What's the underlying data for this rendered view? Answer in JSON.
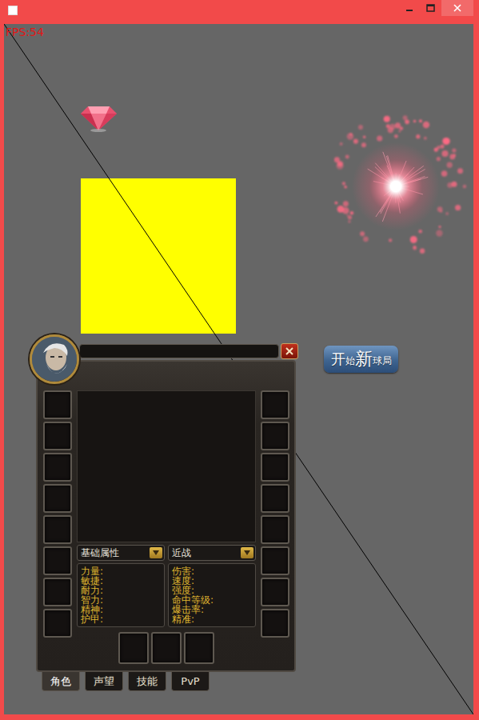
{
  "fps": "FPS:54",
  "button": {
    "segments": [
      {
        "text": "开",
        "kind": "large"
      },
      {
        "text": "始",
        "kind": "small"
      },
      {
        "text": "新",
        "kind": "xlarge"
      },
      {
        "text": "球局",
        "kind": "small"
      }
    ]
  },
  "character_panel": {
    "dropdowns": [
      {
        "label": "基础属性"
      },
      {
        "label": "近战"
      }
    ],
    "stat_groups": [
      {
        "stats": [
          "力量:",
          "敏捷:",
          "耐力:",
          "智力:",
          "精神:",
          "护甲:"
        ]
      },
      {
        "stats": [
          "伤害:",
          "速度:",
          "强度:",
          "命中等级:",
          "爆击率:",
          "精准:"
        ]
      }
    ],
    "tabs": [
      {
        "label": "角色",
        "selected": true
      },
      {
        "label": "声望",
        "selected": false
      },
      {
        "label": "技能",
        "selected": false
      },
      {
        "label": "PvP",
        "selected": false
      }
    ]
  }
}
